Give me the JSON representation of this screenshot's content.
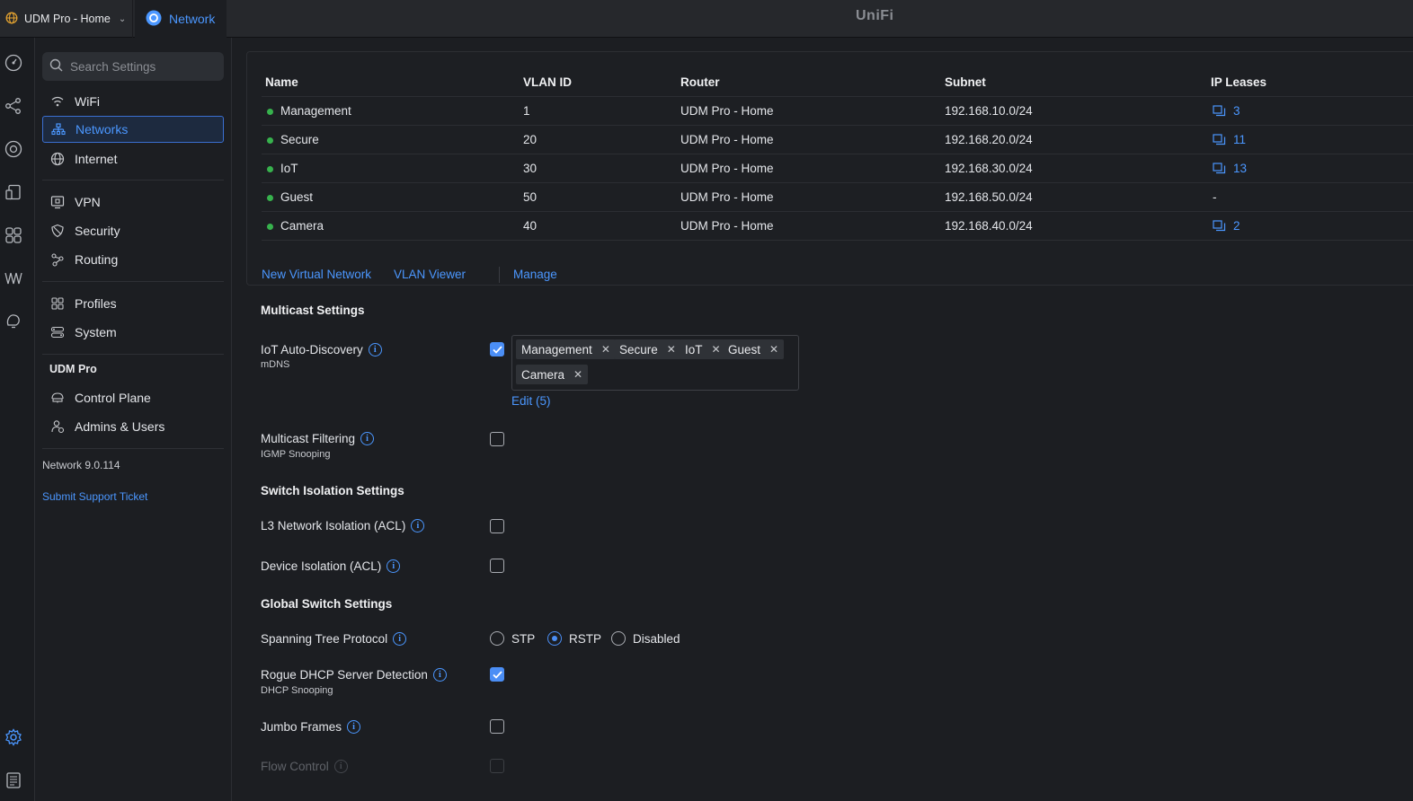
{
  "topbar": {
    "site_name": "UDM Pro - Home",
    "app_name": "Network",
    "logo": "UniFi"
  },
  "rail": {
    "icons": [
      "dashboard-icon",
      "topology-icon",
      "devices-icon",
      "clients-icon",
      "insights-icon",
      "radio-manager-icon",
      "alerts-icon",
      "settings-icon",
      "logs-icon"
    ]
  },
  "sidebar": {
    "search_placeholder": "Search Settings",
    "items": [
      {
        "label": "WiFi",
        "icon": "wifi-icon"
      },
      {
        "label": "Networks",
        "icon": "networks-icon"
      },
      {
        "label": "Internet",
        "icon": "globe-icon"
      },
      {
        "label": "VPN",
        "icon": "vpn-icon"
      },
      {
        "label": "Security",
        "icon": "shield-icon"
      },
      {
        "label": "Routing",
        "icon": "routing-icon"
      },
      {
        "label": "Profiles",
        "icon": "profiles-icon"
      },
      {
        "label": "System",
        "icon": "system-icon"
      }
    ],
    "section_title": "UDM Pro",
    "section_items": [
      {
        "label": "Control Plane",
        "icon": "control-plane-icon"
      },
      {
        "label": "Admins & Users",
        "icon": "admins-icon"
      }
    ],
    "version": "Network 9.0.114",
    "support_link": "Submit Support Ticket"
  },
  "networks_table": {
    "headers": [
      "Name",
      "VLAN ID",
      "Router",
      "Subnet",
      "IP Leases"
    ],
    "rows": [
      {
        "name": "Management",
        "vlan": "1",
        "router": "UDM Pro - Home",
        "subnet": "192.168.10.0/24",
        "leases": "3"
      },
      {
        "name": "Secure",
        "vlan": "20",
        "router": "UDM Pro - Home",
        "subnet": "192.168.20.0/24",
        "leases": "11"
      },
      {
        "name": "IoT",
        "vlan": "30",
        "router": "UDM Pro - Home",
        "subnet": "192.168.30.0/24",
        "leases": "13"
      },
      {
        "name": "Guest",
        "vlan": "50",
        "router": "UDM Pro - Home",
        "subnet": "192.168.50.0/24",
        "leases": "-"
      },
      {
        "name": "Camera",
        "vlan": "40",
        "router": "UDM Pro - Home",
        "subnet": "192.168.40.0/24",
        "leases": "2"
      }
    ],
    "actions": [
      "New Virtual Network",
      "VLAN Viewer",
      "Manage"
    ]
  },
  "multicast": {
    "title": "Multicast Settings",
    "iot_discovery": {
      "label": "IoT Auto-Discovery",
      "sublabel": "mDNS",
      "checked": true,
      "tags": [
        "Management",
        "Secure",
        "IoT",
        "Guest",
        "Camera"
      ],
      "edit_label": "Edit (5)"
    },
    "filtering": {
      "label": "Multicast Filtering",
      "sublabel": "IGMP Snooping",
      "checked": false
    }
  },
  "switch_isolation": {
    "title": "Switch Isolation Settings",
    "l3_label": "L3 Network Isolation (ACL)",
    "device_label": "Device Isolation (ACL)"
  },
  "global_switch": {
    "title": "Global Switch Settings",
    "stp_label": "Spanning Tree Protocol",
    "stp_options": [
      "STP",
      "RSTP",
      "Disabled"
    ],
    "stp_selected": "RSTP",
    "rogue_label": "Rogue DHCP Server Detection",
    "rogue_sublabel": "DHCP Snooping",
    "rogue_checked": true,
    "jumbo_label": "Jumbo Frames",
    "flow_label": "Flow Control"
  },
  "colors": {
    "accent": "#4b97ff",
    "status_green": "#37b24d",
    "background": "#1c1e22"
  }
}
